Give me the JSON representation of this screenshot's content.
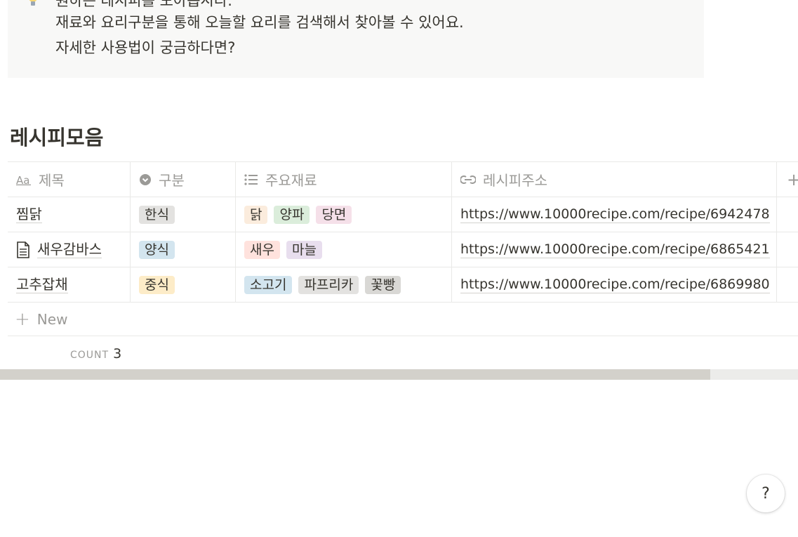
{
  "callout": {
    "icon": "lightbulb-icon",
    "lines": [
      "원하는 레시피를 모아봅시다.",
      "재료와 요리구분을 통해 오늘할 요리를 검색해서 찾아볼 수 있어요.",
      "자세한 사용법이 궁금하다면?"
    ]
  },
  "database": {
    "title": "레시피모음",
    "columns": [
      {
        "icon": "text-icon",
        "label": "제목"
      },
      {
        "icon": "select-icon",
        "label": "구분"
      },
      {
        "icon": "list-icon",
        "label": "주요재료"
      },
      {
        "icon": "link-icon",
        "label": "레시피주소"
      },
      {
        "icon": "plus-icon",
        "label": "+"
      }
    ],
    "rows": [
      {
        "title": "찜닭",
        "category": {
          "label": "한식",
          "color": "#e3e2e0"
        },
        "ingredients": [
          {
            "label": "닭",
            "color": "#fbecdd"
          },
          {
            "label": "양파",
            "color": "#dbeddb"
          },
          {
            "label": "당면",
            "color": "#f5e0e9"
          }
        ],
        "url": "https://www.10000recipe.com/recipe/6942478"
      },
      {
        "title": "새우감바스",
        "category": {
          "label": "양식",
          "color": "#d3e5ef"
        },
        "ingredients": [
          {
            "label": "새우",
            "color": "#ffe2dd"
          },
          {
            "label": "마늘",
            "color": "#e8deee"
          }
        ],
        "url": "https://www.10000recipe.com/recipe/6865421"
      },
      {
        "title": "고추잡채",
        "category": {
          "label": "중식",
          "color": "#fdecc8"
        },
        "ingredients": [
          {
            "label": "소고기",
            "color": "#d3e5ef"
          },
          {
            "label": "파프리카",
            "color": "#e3e2e0"
          },
          {
            "label": "꽃빵",
            "color": "#e3e2e0"
          }
        ],
        "url": "https://www.10000recipe.com/recipe/6869980"
      }
    ],
    "new_label": "New",
    "count_label": "COUNT",
    "count_value": "3"
  },
  "help": {
    "label": "?"
  }
}
